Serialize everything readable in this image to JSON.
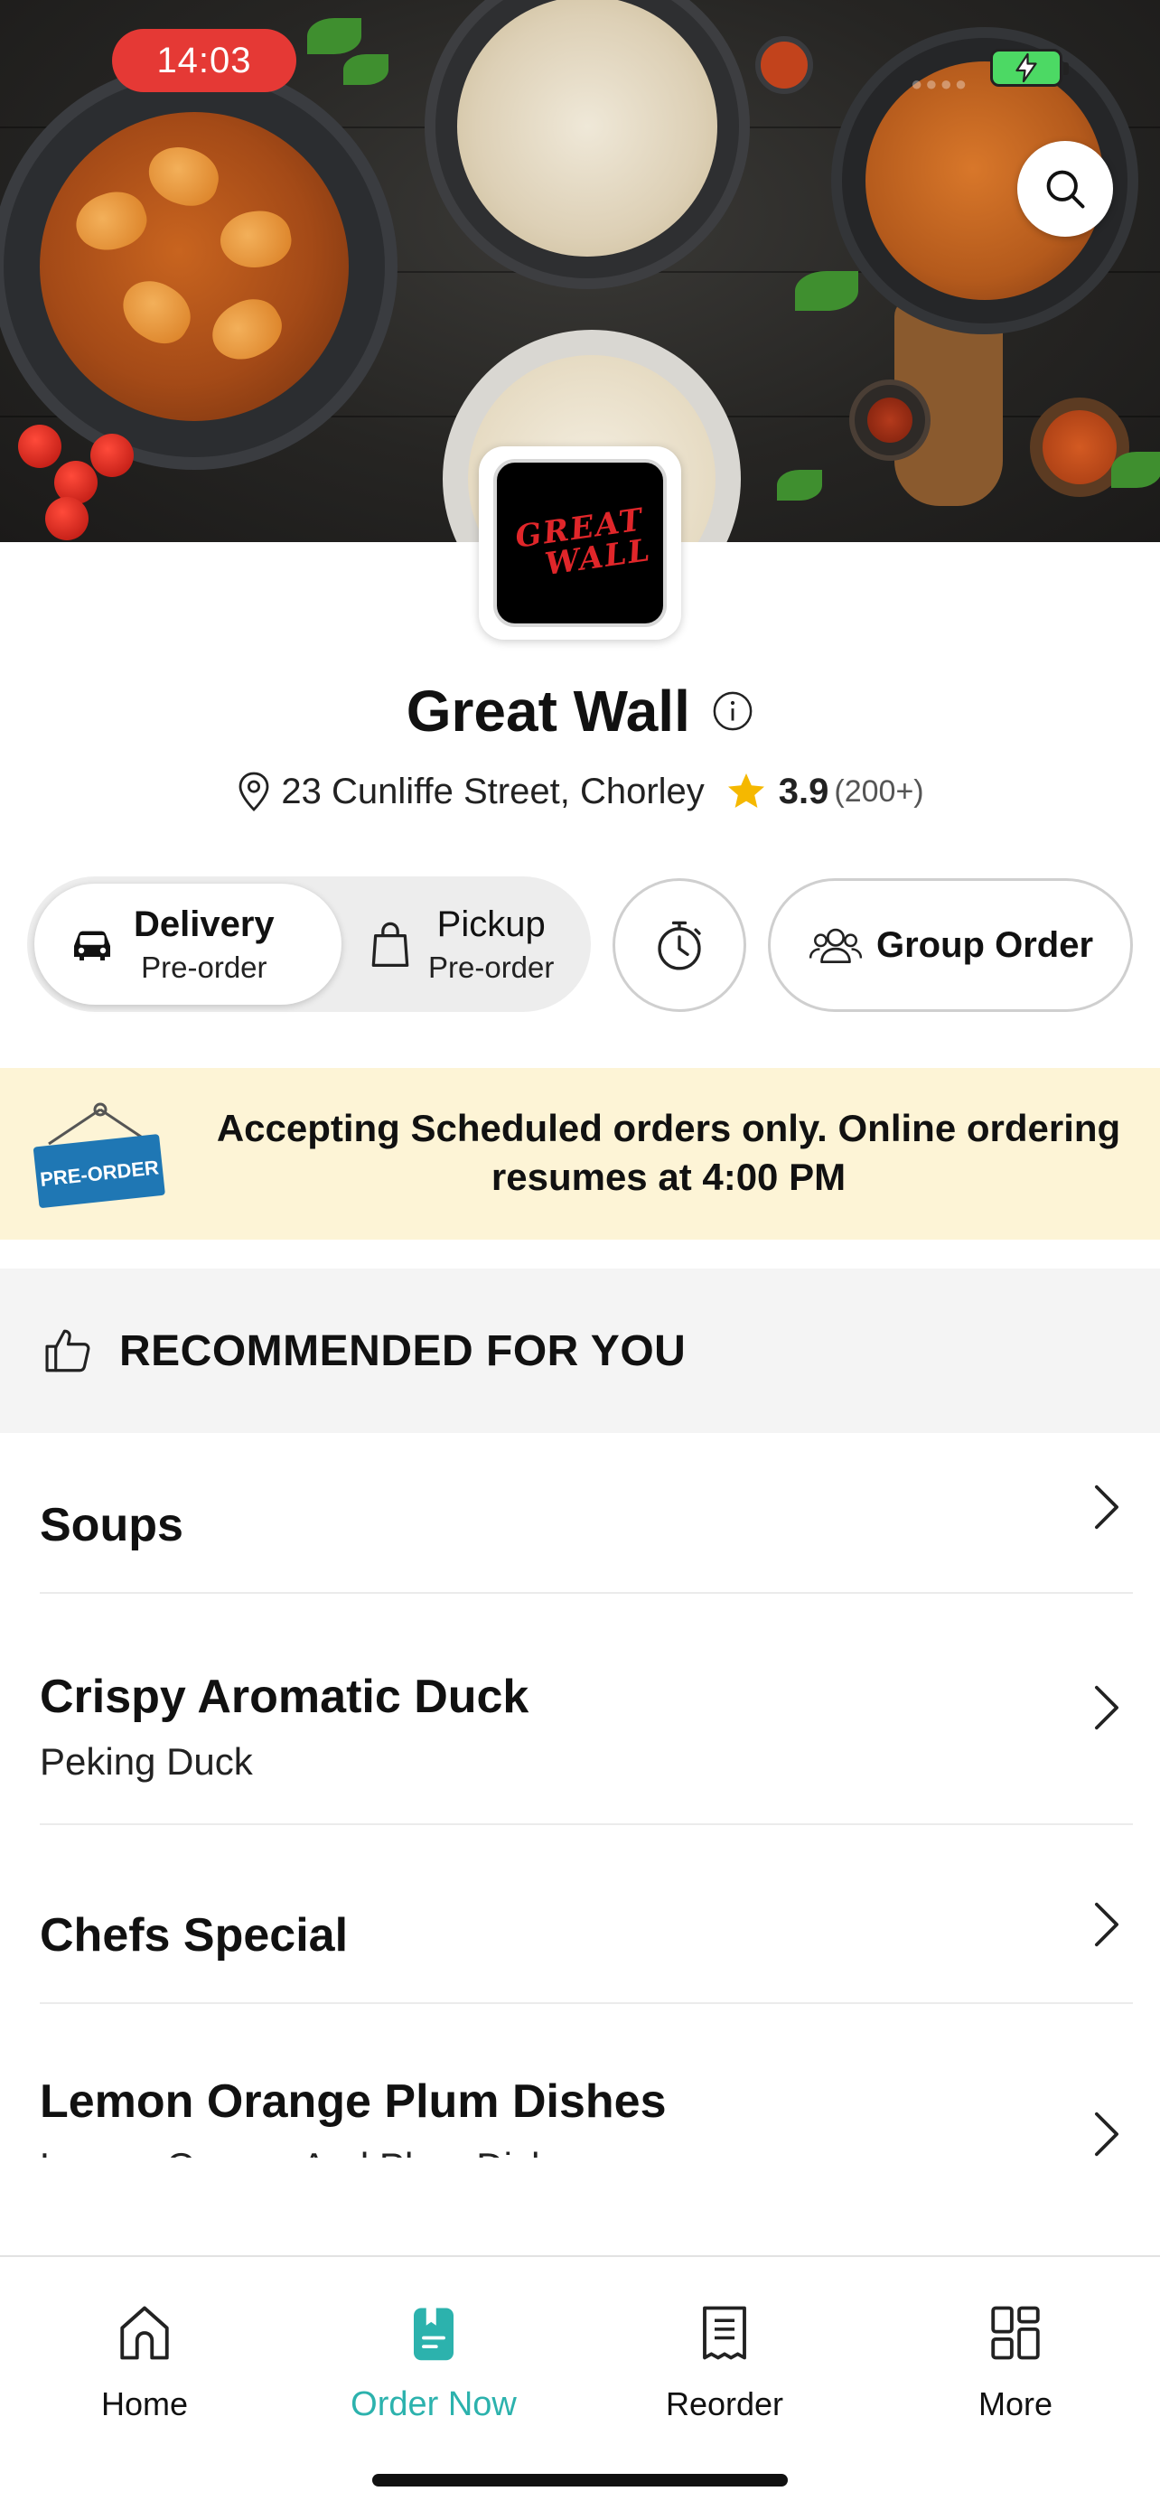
{
  "status_bar": {
    "time": "14:03"
  },
  "restaurant": {
    "name": "Great Wall",
    "logo_text": [
      "GREAT",
      "WALL"
    ],
    "address": "23 Cunliffe Street, Chorley",
    "rating": "3.9",
    "rating_count": "(200+)"
  },
  "order_mode": {
    "delivery": {
      "label": "Delivery",
      "sub": "Pre-order",
      "selected": true
    },
    "pickup": {
      "label": "Pickup",
      "sub": "Pre-order",
      "selected": false
    },
    "group_order_label": "Group Order"
  },
  "banner": {
    "sign_text": "PRE-ORDER",
    "message": "Accepting Scheduled orders only. Online ordering resumes at 4:00 PM"
  },
  "recommended": {
    "label": "RECOMMENDED FOR YOU"
  },
  "categories": [
    {
      "name": "Soups",
      "subtitle": ""
    },
    {
      "name": "Crispy Aromatic Duck",
      "subtitle": "Peking Duck"
    },
    {
      "name": "Chefs Special",
      "subtitle": ""
    },
    {
      "name": "Lemon Orange Plum Dishes",
      "subtitle": "Lemon Orange And Plum Dishes"
    }
  ],
  "bottom_nav": [
    {
      "label": "Home",
      "icon": "home-icon",
      "active": false
    },
    {
      "label": "Order Now",
      "icon": "order-now-icon",
      "active": true
    },
    {
      "label": "Reorder",
      "icon": "receipt-icon",
      "active": false
    },
    {
      "label": "More",
      "icon": "grid-icon",
      "active": false
    }
  ],
  "colors": {
    "accent": "#2cb2ad",
    "time_pill": "#e53935",
    "star": "#f5b800",
    "banner_bg": "#fdf4d6",
    "battery": "#4cd964",
    "logo_text": "#e0262a"
  }
}
